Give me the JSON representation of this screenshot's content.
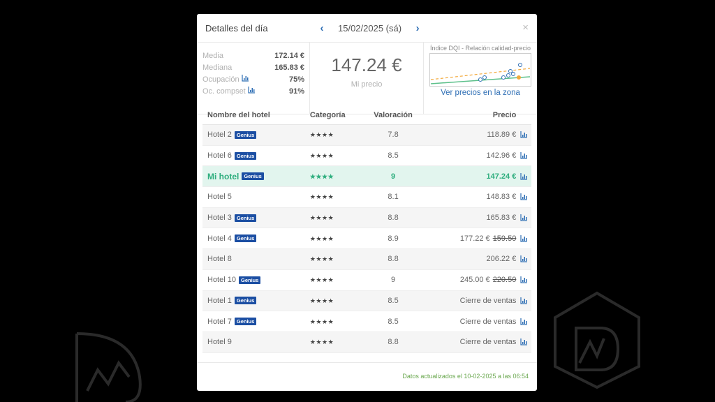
{
  "modal": {
    "title": "Detalles del día",
    "date": "15/02/2025 (sá)",
    "prev_icon": "chevron-left-icon",
    "next_icon": "chevron-right-icon",
    "close_label": "×"
  },
  "summary": {
    "stats": [
      {
        "label": "Media",
        "value": "172.14 €",
        "has_icon": false
      },
      {
        "label": "Mediana",
        "value": "165.83 €",
        "has_icon": false
      },
      {
        "label": "Ocupación",
        "value": "75%",
        "has_icon": true
      },
      {
        "label": "Oc. compset",
        "value": "91%",
        "has_icon": true
      }
    ],
    "my_price_value": "147.24 €",
    "my_price_label": "Mi precio",
    "dqi_title": "Índice DQI - Relación calidad-precio",
    "dqi_link": "Ver precios en la zona"
  },
  "table": {
    "headers": {
      "name": "Nombre del hotel",
      "category": "Categoría",
      "rating": "Valoración",
      "price": "Precio"
    },
    "rows": [
      {
        "name": "Hotel 2",
        "genius": "Genius",
        "stars": "★★★★",
        "rating": "7.8",
        "price": "118.89 €",
        "old_price": ""
      },
      {
        "name": "Hotel 6",
        "genius": "Genius",
        "stars": "★★★★",
        "rating": "8.5",
        "price": "142.96 €",
        "old_price": ""
      },
      {
        "name": "Mi hotel",
        "genius": "Genius",
        "stars": "★★★★",
        "rating": "9",
        "price": "147.24 €",
        "old_price": "",
        "mine": true
      },
      {
        "name": "Hotel 5",
        "genius": "",
        "stars": "★★★★",
        "rating": "8.1",
        "price": "148.83 €",
        "old_price": ""
      },
      {
        "name": "Hotel 3",
        "genius": "Genius",
        "stars": "★★★★",
        "rating": "8.8",
        "price": "165.83 €",
        "old_price": ""
      },
      {
        "name": "Hotel 4",
        "genius": "Genius",
        "stars": "★★★★",
        "rating": "8.9",
        "price": "177.22 €",
        "old_price": "159.50"
      },
      {
        "name": "Hotel 8",
        "genius": "",
        "stars": "★★★★",
        "rating": "8.8",
        "price": "206.22 €",
        "old_price": ""
      },
      {
        "name": "Hotel 10",
        "genius": "Genius",
        "stars": "★★★★",
        "rating": "9",
        "price": "245.00 €",
        "old_price": "220.50"
      },
      {
        "name": "Hotel 1",
        "genius": "Genius",
        "stars": "★★★★",
        "rating": "8.5",
        "price": "Cierre de ventas",
        "old_price": ""
      },
      {
        "name": "Hotel 7",
        "genius": "Genius",
        "stars": "★★★★",
        "rating": "8.5",
        "price": "Cierre de ventas",
        "old_price": ""
      },
      {
        "name": "Hotel 9",
        "genius": "",
        "stars": "★★★★",
        "rating": "8.8",
        "price": "Cierre de ventas",
        "old_price": ""
      }
    ]
  },
  "footer": {
    "updated": "Datos actualizados el 10-02-2025 a las 06:54"
  },
  "colors": {
    "accent_blue": "#2f6fb5",
    "mine_green": "#2eae7e",
    "genius_blue": "#1c4fa3",
    "footer_green": "#6aa84f",
    "dqi_orange": "#f2a93b"
  }
}
